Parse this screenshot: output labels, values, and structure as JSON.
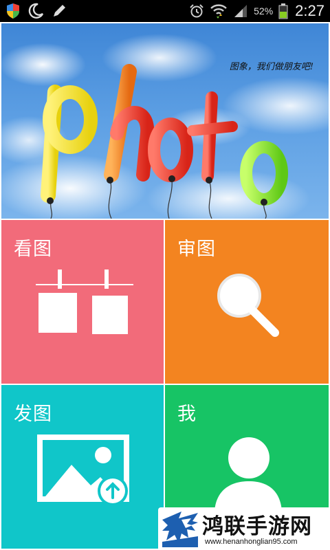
{
  "status_bar": {
    "battery": "52%",
    "time": "2:27",
    "icons": [
      "shield-icon",
      "moon-icon",
      "pen-icon",
      "alarm-icon",
      "wifi-icon",
      "signal-icon",
      "battery-icon"
    ]
  },
  "banner": {
    "title": "photo",
    "tagline": "图象，我们做朋友吧!",
    "balloon_colors": [
      "#f4e21a",
      "#f07d1c",
      "#e8321f",
      "#e8321f",
      "#e8321f",
      "#7ee11d"
    ]
  },
  "tiles": {
    "view": {
      "label": "看图",
      "icon": "photos-on-line-icon",
      "color": "#f26b7a"
    },
    "review": {
      "label": "审图",
      "icon": "magnifier-icon",
      "color": "#f38420"
    },
    "post": {
      "label": "发图",
      "icon": "image-upload-icon",
      "color": "#10c6c9"
    },
    "me": {
      "label": "我",
      "icon": "user-icon",
      "color": "#17c465"
    }
  },
  "watermark": {
    "title": "鸿联手游网",
    "url": "www.henanhonglian95.com"
  }
}
